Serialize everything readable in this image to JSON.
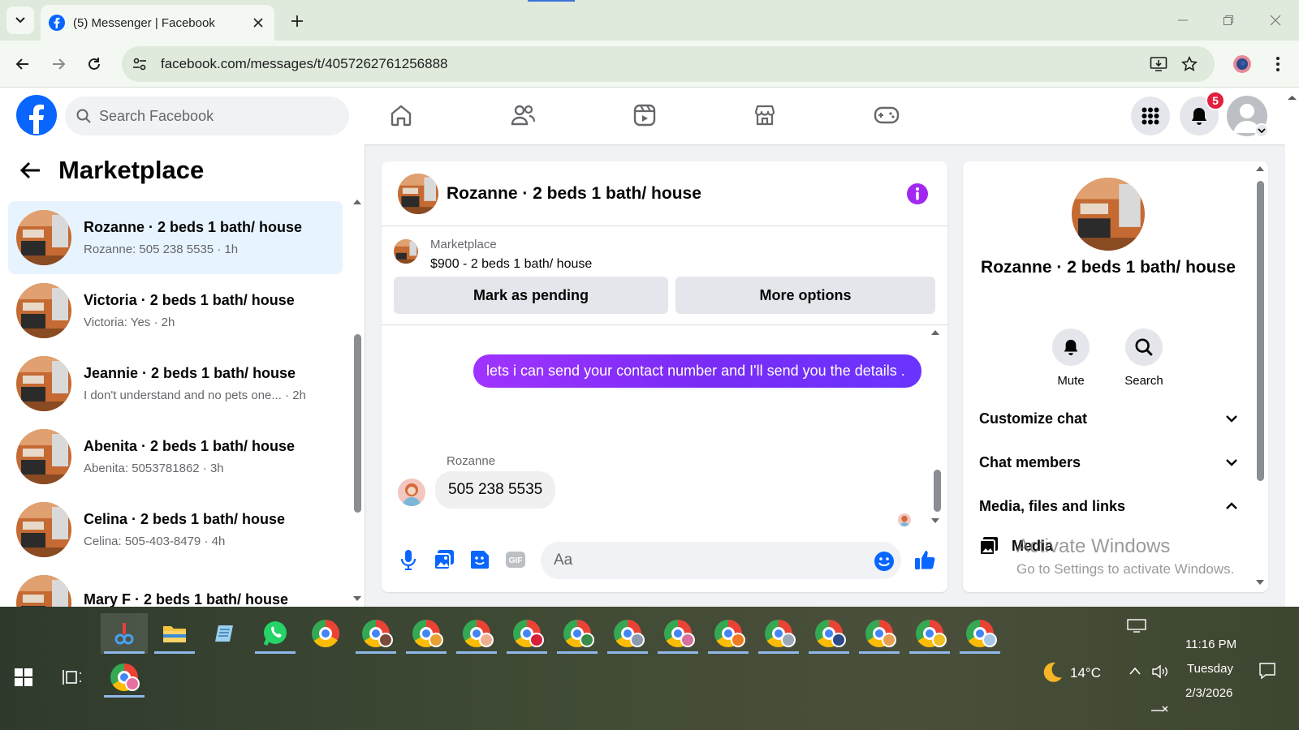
{
  "browser": {
    "tab_title": "(5) Messenger | Facebook",
    "url": "facebook.com/messages/t/4057262761256888"
  },
  "header": {
    "search_placeholder": "Search Facebook",
    "notification_count": "5"
  },
  "sidebar": {
    "title": "Marketplace",
    "conversations": [
      {
        "name": "Rozanne · 2 beds 1 bath/ house",
        "snippet": "Rozanne: 505 238 5535 · 1h"
      },
      {
        "name": "Victoria · 2 beds 1 bath/ house",
        "snippet": "Victoria: Yes · 2h"
      },
      {
        "name": "Jeannie · 2 beds 1 bath/ house",
        "snippet": "I don't understand and no pets one... · 2h"
      },
      {
        "name": "Abenita · 2 beds 1 bath/ house",
        "snippet": "Abenita: 5053781862 · 3h"
      },
      {
        "name": "Celina · 2 beds 1 bath/ house",
        "snippet": "Celina: 505-403-8479 · 4h"
      },
      {
        "name": "Mary F · 2 beds 1 bath/ house",
        "snippet": ""
      }
    ]
  },
  "chat": {
    "title": "Rozanne · 2 beds 1 bath/ house",
    "listing_label": "Marketplace",
    "listing_price": "$900 - 2 beds 1 bath/ house",
    "mark_pending_label": "Mark as pending",
    "more_options_label": "More options",
    "outgoing_message": "lets i can send your contact number and I'll send you the details .",
    "sender_name": "Rozanne",
    "incoming_message": "505 238 5535",
    "composer_placeholder": "Aa",
    "gif_label": "GIF"
  },
  "details": {
    "name": "Rozanne · 2 beds 1 bath/ house",
    "mute_label": "Mute",
    "search_label": "Search",
    "customize_label": "Customize chat",
    "members_label": "Chat members",
    "media_files_label": "Media, files and links",
    "media_label": "Media"
  },
  "watermark": {
    "line1": "Activate Windows",
    "line2": "Go to Settings to activate Windows."
  },
  "taskbar": {
    "temperature": "14°C",
    "time": "11:16 PM",
    "day": "Tuesday",
    "date": "2/3/2026"
  },
  "colors": {
    "facebook_blue": "#0866ff",
    "messenger_purple": "#8a2cf5",
    "active_conversation": "#e7f3ff",
    "badge_red": "#e41e3f"
  }
}
